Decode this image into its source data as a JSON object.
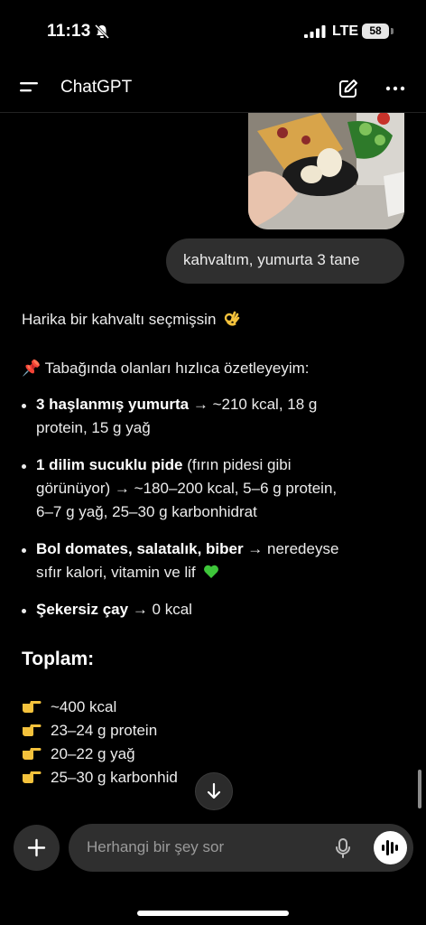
{
  "status_bar": {
    "time": "11:13",
    "network": "LTE",
    "battery": "58"
  },
  "header": {
    "title": "ChatGPT"
  },
  "user_message": "kahvaltım, yumurta 3 tane",
  "assistant": {
    "intro": "Harika bir kahvaltı seçmişsin",
    "summary_intro": "📌 Tabağında olanları hızlıca özetleyeyim:",
    "items": [
      {
        "bold": "3 haşlanmış yumurta",
        "line1": " → ~210 kcal, 18 g",
        "line2": "protein, 15 g yağ"
      },
      {
        "bold": "1 dilim sucuklu pide",
        "line1": " (fırın pidesi gibi",
        "line2": "görünüyor) → ~180–200 kcal, 5–6 g protein,",
        "line3": "6–7 g yağ, 25–30 g karbonhidrat"
      },
      {
        "bold": "Bol domates, salatalık, biber",
        "line1": " → neredeyse",
        "line2": "sıfır kalori, vitamin ve lif"
      },
      {
        "bold": "Şekersiz çay",
        "line1": " → 0 kcal"
      }
    ],
    "total_heading": "Toplam:",
    "totals": [
      "~400 kcal",
      "23–24 g protein",
      "20–22 g yağ",
      "25–30 g karbonhid"
    ]
  },
  "composer": {
    "placeholder": "Herhangi bir şey sor"
  }
}
